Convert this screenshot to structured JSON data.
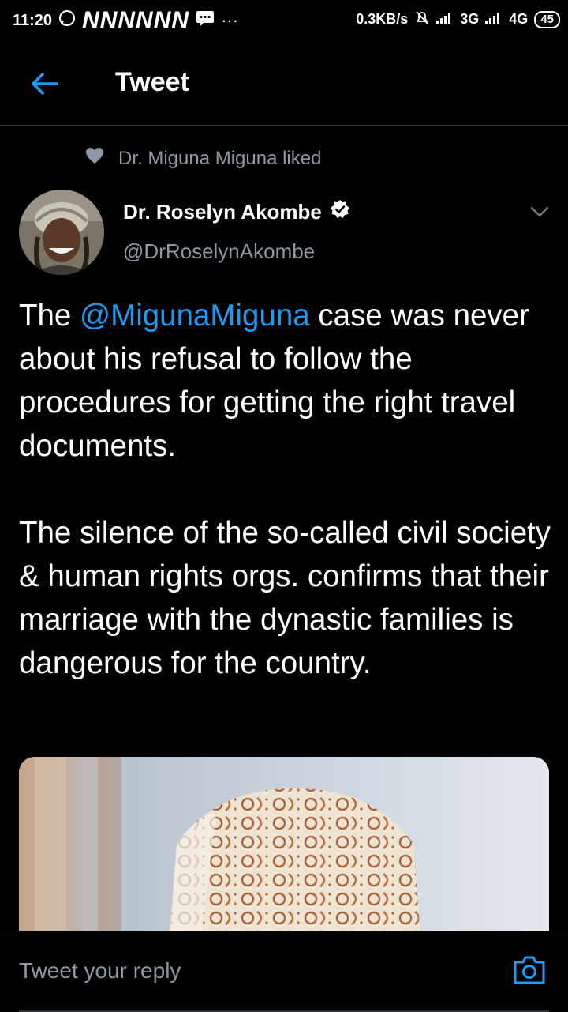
{
  "status_bar": {
    "time": "11:20",
    "carrier_marks": "NNNNNN",
    "speed": "0.3KB/s",
    "network1": "3G",
    "network2": "4G",
    "battery": "45"
  },
  "header": {
    "title": "Tweet"
  },
  "social_context": {
    "text": "Dr. Miguna Miguna liked"
  },
  "author": {
    "name": "Dr. Roselyn Akombe",
    "handle": "@DrRoselynAkombe"
  },
  "tweet": {
    "para1_start": "The ",
    "mention": "@MigunaMiguna",
    "para1_end": " case was never about his refusal to follow the procedures for getting the right travel documents.",
    "para2": "The silence of the so-called civil society & human rights orgs. confirms that their marriage with the dynastic families is dangerous for the country."
  },
  "reply": {
    "placeholder": "Tweet your reply"
  },
  "colors": {
    "accent": "#1d9bf0",
    "secondary_text": "#8b98a5",
    "background": "#000000"
  }
}
